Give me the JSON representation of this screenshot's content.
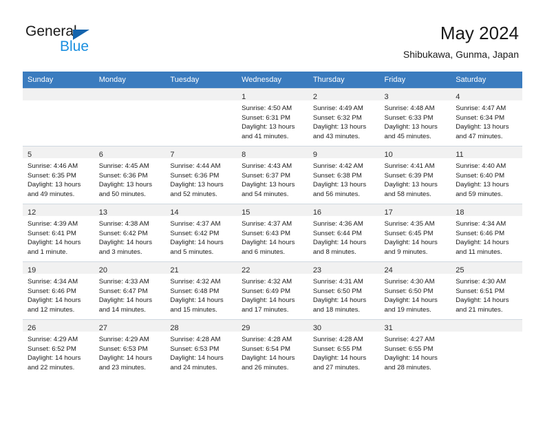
{
  "brand": {
    "name_part1": "General",
    "name_part2": "Blue",
    "triangle_icon": "triangle-icon",
    "accent_dark": "#1464ad",
    "accent_light": "#1a8fe0"
  },
  "header": {
    "title": "May 2024",
    "subtitle": "Shibukawa, Gunma, Japan"
  },
  "theme": {
    "header_row_bg": "#3b7cbf",
    "header_row_text": "#ffffff",
    "daynum_bar_bg": "#f1f1f1",
    "cell_border": "#cfd8e0"
  },
  "weekdays": [
    "Sunday",
    "Monday",
    "Tuesday",
    "Wednesday",
    "Thursday",
    "Friday",
    "Saturday"
  ],
  "weeks": [
    [
      {
        "day": "",
        "lines": []
      },
      {
        "day": "",
        "lines": []
      },
      {
        "day": "",
        "lines": []
      },
      {
        "day": "1",
        "lines": [
          "Sunrise: 4:50 AM",
          "Sunset: 6:31 PM",
          "Daylight: 13 hours",
          "and 41 minutes."
        ]
      },
      {
        "day": "2",
        "lines": [
          "Sunrise: 4:49 AM",
          "Sunset: 6:32 PM",
          "Daylight: 13 hours",
          "and 43 minutes."
        ]
      },
      {
        "day": "3",
        "lines": [
          "Sunrise: 4:48 AM",
          "Sunset: 6:33 PM",
          "Daylight: 13 hours",
          "and 45 minutes."
        ]
      },
      {
        "day": "4",
        "lines": [
          "Sunrise: 4:47 AM",
          "Sunset: 6:34 PM",
          "Daylight: 13 hours",
          "and 47 minutes."
        ]
      }
    ],
    [
      {
        "day": "5",
        "lines": [
          "Sunrise: 4:46 AM",
          "Sunset: 6:35 PM",
          "Daylight: 13 hours",
          "and 49 minutes."
        ]
      },
      {
        "day": "6",
        "lines": [
          "Sunrise: 4:45 AM",
          "Sunset: 6:36 PM",
          "Daylight: 13 hours",
          "and 50 minutes."
        ]
      },
      {
        "day": "7",
        "lines": [
          "Sunrise: 4:44 AM",
          "Sunset: 6:36 PM",
          "Daylight: 13 hours",
          "and 52 minutes."
        ]
      },
      {
        "day": "8",
        "lines": [
          "Sunrise: 4:43 AM",
          "Sunset: 6:37 PM",
          "Daylight: 13 hours",
          "and 54 minutes."
        ]
      },
      {
        "day": "9",
        "lines": [
          "Sunrise: 4:42 AM",
          "Sunset: 6:38 PM",
          "Daylight: 13 hours",
          "and 56 minutes."
        ]
      },
      {
        "day": "10",
        "lines": [
          "Sunrise: 4:41 AM",
          "Sunset: 6:39 PM",
          "Daylight: 13 hours",
          "and 58 minutes."
        ]
      },
      {
        "day": "11",
        "lines": [
          "Sunrise: 4:40 AM",
          "Sunset: 6:40 PM",
          "Daylight: 13 hours",
          "and 59 minutes."
        ]
      }
    ],
    [
      {
        "day": "12",
        "lines": [
          "Sunrise: 4:39 AM",
          "Sunset: 6:41 PM",
          "Daylight: 14 hours",
          "and 1 minute."
        ]
      },
      {
        "day": "13",
        "lines": [
          "Sunrise: 4:38 AM",
          "Sunset: 6:42 PM",
          "Daylight: 14 hours",
          "and 3 minutes."
        ]
      },
      {
        "day": "14",
        "lines": [
          "Sunrise: 4:37 AM",
          "Sunset: 6:42 PM",
          "Daylight: 14 hours",
          "and 5 minutes."
        ]
      },
      {
        "day": "15",
        "lines": [
          "Sunrise: 4:37 AM",
          "Sunset: 6:43 PM",
          "Daylight: 14 hours",
          "and 6 minutes."
        ]
      },
      {
        "day": "16",
        "lines": [
          "Sunrise: 4:36 AM",
          "Sunset: 6:44 PM",
          "Daylight: 14 hours",
          "and 8 minutes."
        ]
      },
      {
        "day": "17",
        "lines": [
          "Sunrise: 4:35 AM",
          "Sunset: 6:45 PM",
          "Daylight: 14 hours",
          "and 9 minutes."
        ]
      },
      {
        "day": "18",
        "lines": [
          "Sunrise: 4:34 AM",
          "Sunset: 6:46 PM",
          "Daylight: 14 hours",
          "and 11 minutes."
        ]
      }
    ],
    [
      {
        "day": "19",
        "lines": [
          "Sunrise: 4:34 AM",
          "Sunset: 6:46 PM",
          "Daylight: 14 hours",
          "and 12 minutes."
        ]
      },
      {
        "day": "20",
        "lines": [
          "Sunrise: 4:33 AM",
          "Sunset: 6:47 PM",
          "Daylight: 14 hours",
          "and 14 minutes."
        ]
      },
      {
        "day": "21",
        "lines": [
          "Sunrise: 4:32 AM",
          "Sunset: 6:48 PM",
          "Daylight: 14 hours",
          "and 15 minutes."
        ]
      },
      {
        "day": "22",
        "lines": [
          "Sunrise: 4:32 AM",
          "Sunset: 6:49 PM",
          "Daylight: 14 hours",
          "and 17 minutes."
        ]
      },
      {
        "day": "23",
        "lines": [
          "Sunrise: 4:31 AM",
          "Sunset: 6:50 PM",
          "Daylight: 14 hours",
          "and 18 minutes."
        ]
      },
      {
        "day": "24",
        "lines": [
          "Sunrise: 4:30 AM",
          "Sunset: 6:50 PM",
          "Daylight: 14 hours",
          "and 19 minutes."
        ]
      },
      {
        "day": "25",
        "lines": [
          "Sunrise: 4:30 AM",
          "Sunset: 6:51 PM",
          "Daylight: 14 hours",
          "and 21 minutes."
        ]
      }
    ],
    [
      {
        "day": "26",
        "lines": [
          "Sunrise: 4:29 AM",
          "Sunset: 6:52 PM",
          "Daylight: 14 hours",
          "and 22 minutes."
        ]
      },
      {
        "day": "27",
        "lines": [
          "Sunrise: 4:29 AM",
          "Sunset: 6:53 PM",
          "Daylight: 14 hours",
          "and 23 minutes."
        ]
      },
      {
        "day": "28",
        "lines": [
          "Sunrise: 4:28 AM",
          "Sunset: 6:53 PM",
          "Daylight: 14 hours",
          "and 24 minutes."
        ]
      },
      {
        "day": "29",
        "lines": [
          "Sunrise: 4:28 AM",
          "Sunset: 6:54 PM",
          "Daylight: 14 hours",
          "and 26 minutes."
        ]
      },
      {
        "day": "30",
        "lines": [
          "Sunrise: 4:28 AM",
          "Sunset: 6:55 PM",
          "Daylight: 14 hours",
          "and 27 minutes."
        ]
      },
      {
        "day": "31",
        "lines": [
          "Sunrise: 4:27 AM",
          "Sunset: 6:55 PM",
          "Daylight: 14 hours",
          "and 28 minutes."
        ]
      },
      {
        "day": "",
        "lines": []
      }
    ]
  ]
}
